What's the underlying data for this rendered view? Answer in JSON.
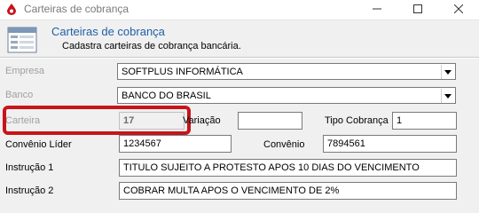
{
  "window": {
    "title": "Carteiras de cobrança"
  },
  "colors": {
    "highlight": "#c8141b",
    "header_title": "#1f5fa8",
    "disabled_text": "#a0a0a0"
  },
  "icons": [
    "app-drop-icon",
    "form-icon",
    "minimize-icon",
    "maximize-icon",
    "close-icon",
    "chevron-down-icon"
  ],
  "header": {
    "title": "Carteiras de cobrança",
    "subtitle": "Cadastra carteiras de cobrança bancária."
  },
  "form": {
    "empresa_label": "Empresa",
    "empresa_value": "SOFTPLUS INFORMÁTICA",
    "banco_label": "Banco",
    "banco_value": "BANCO DO BRASIL",
    "carteira_label": "Carteira",
    "carteira_value": "17",
    "variacao_label": "Variação",
    "variacao_value": "",
    "tipo_cobranca_label": "Tipo Cobrança",
    "tipo_cobranca_value": "1",
    "convenio_lider_label": "Convênio Líder",
    "convenio_lider_value": "1234567",
    "convenio_label": "Convênio",
    "convenio_value": "7894561",
    "instrucao1_label": "Instrução 1",
    "instrucao1_value": "TITULO SUJEITO A PROTESTO APOS 10 DIAS DO VENCIMENTO",
    "instrucao2_label": "Instrução 2",
    "instrucao2_value": "COBRAR MULTA APOS O VENCIMENTO DE 2%"
  }
}
